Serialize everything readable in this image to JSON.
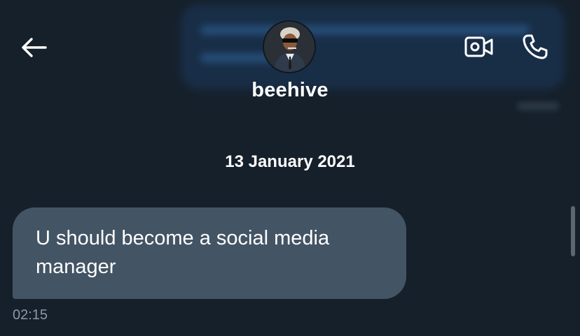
{
  "header": {
    "back_icon": "arrow-left-icon",
    "contact_name": "beehive",
    "video_icon": "video-camera-icon",
    "call_icon": "phone-icon"
  },
  "conversation": {
    "date": "13 January 2021",
    "messages": [
      {
        "text": "U should become a social media manager",
        "time": "02:15",
        "direction": "received"
      }
    ]
  },
  "colors": {
    "background": "#15202b",
    "received_bubble": "#435465",
    "timestamp": "#8b98a5",
    "text": "#ffffff"
  }
}
